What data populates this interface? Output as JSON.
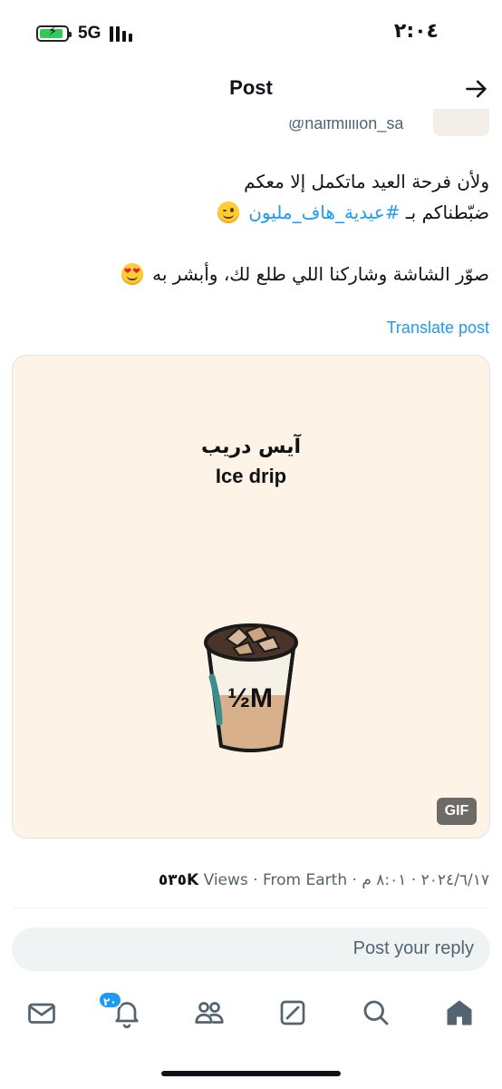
{
  "status_bar": {
    "network": "5G",
    "time": "٢:٠٤",
    "battery_level": 0.9
  },
  "header": {
    "title": "Post",
    "handle": "@halfmillion_sa"
  },
  "post": {
    "line1": "ولأن فرحة العيد ماتكمل إلا معكم",
    "line2_prefix": "ضبّطناكم بـ ",
    "hashtag": "#عيدية_هاف_مليون",
    "line3": "صوّر الشاشة وشاركنا اللي طلع لك، وأبشر به",
    "translate": "Translate post",
    "media": {
      "title_ar": "آيس دريب",
      "title_en": "Ice drip",
      "cup_label": "½M",
      "badge": "GIF"
    },
    "meta": {
      "date_time": "٢٠٢٤/٦/١٧ · ٨:٠١ م",
      "from": "From Earth",
      "views_label": "Views",
      "views_count": "٥٣٥K"
    }
  },
  "reply": {
    "placeholder": "Post your reply"
  },
  "tabs": {
    "notifications_badge": "٢٠",
    "icons": [
      "mail-icon",
      "bell-icon",
      "people-icon",
      "grok-icon",
      "search-icon",
      "home-icon"
    ]
  },
  "colors": {
    "accent": "#1d9bf0",
    "text": "#0f1419",
    "secondary": "#536471",
    "card_bg": "#fdf3e6"
  }
}
